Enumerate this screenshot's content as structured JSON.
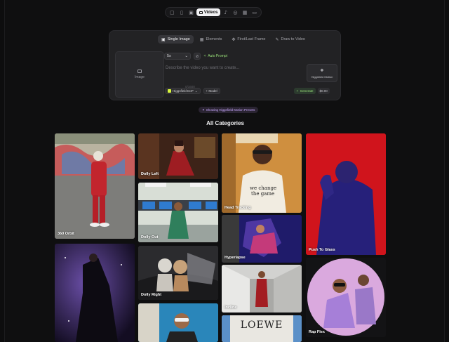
{
  "toolbar": {
    "icons": [
      "chat-icon",
      "trash-icon",
      "image-icon",
      "video-icon",
      "music-icon",
      "settings-icon",
      "grid-icon",
      "folder-icon"
    ],
    "active_label": "Videos"
  },
  "generator": {
    "tabs": [
      {
        "label": "Single Image",
        "icon": "image-icon",
        "active": true
      },
      {
        "label": "Elements",
        "icon": "grid-icon",
        "active": false
      },
      {
        "label": "First/Last Frame",
        "icon": "move-icon",
        "active": false
      },
      {
        "label": "Draw to Video",
        "icon": "brush-icon",
        "active": false
      }
    ],
    "image_label": "Image",
    "duration": "5s",
    "auto_prompt": "Auto Prompt",
    "prompt_placeholder": "Describe the video you want to create...",
    "counter": "0/1600",
    "model_chip": "Higgsfield DoP",
    "model_add": "+ Model",
    "motion_label": "Higgsfield Motion",
    "generate_label": "Generate",
    "price_label": "$0.00"
  },
  "badge": "Showing Higgsfield Motion Presets",
  "heading": "All Categories",
  "gallery": [
    {
      "label": "360 Orbit"
    },
    {
      "label": "Dolly Left"
    },
    {
      "label": "Dolly Out"
    },
    {
      "label": "Dolly Right"
    },
    {
      "label": ""
    },
    {
      "label": "Head Tracking"
    },
    {
      "label": "Hyperlapse"
    },
    {
      "label": "Incline"
    },
    {
      "label": "LOEWE"
    },
    {
      "label": "Push To Glass"
    },
    {
      "label": "Rap Flex"
    },
    {
      "label": ""
    }
  ],
  "colors": {
    "accent_green": "#9be37a",
    "accent_yellow": "#d7f53c",
    "badge_purple": "#c9a9ff",
    "background": "#0f0f10"
  }
}
